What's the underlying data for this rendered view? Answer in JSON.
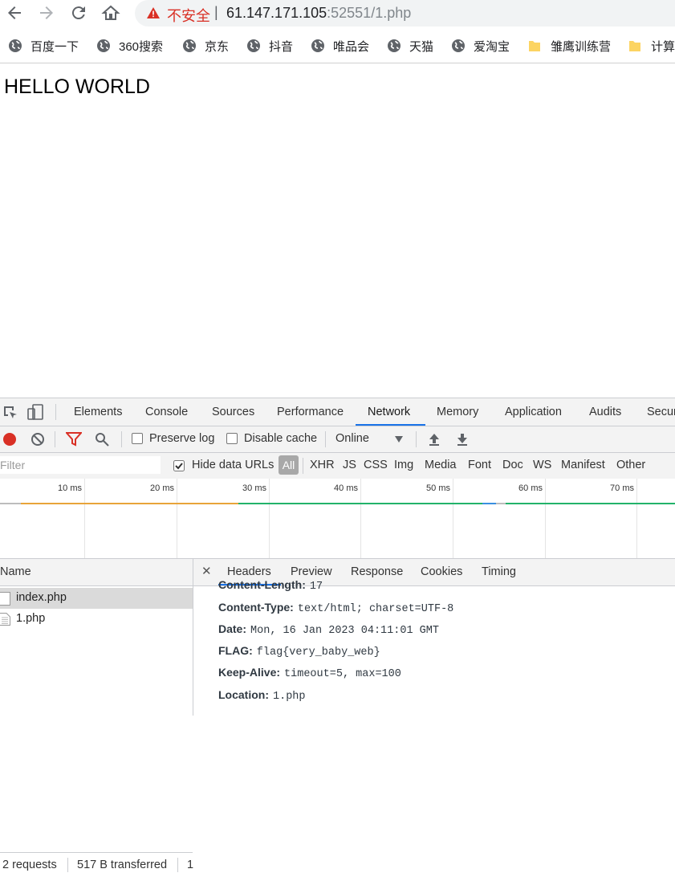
{
  "browser": {
    "security_label": "不安全",
    "url_host": "61.147.171.105",
    "url_port": ":52551",
    "url_path": "/1.php",
    "bookmarks": [
      {
        "label": "百度一下",
        "icon": "globe-icon"
      },
      {
        "label": "360搜索",
        "icon": "globe-icon"
      },
      {
        "label": "京东",
        "icon": "globe-icon"
      },
      {
        "label": "抖音",
        "icon": "globe-icon"
      },
      {
        "label": "唯品会",
        "icon": "globe-icon"
      },
      {
        "label": "天猫",
        "icon": "globe-icon"
      },
      {
        "label": "爱淘宝",
        "icon": "globe-icon"
      },
      {
        "label": "雏鹰训练营",
        "icon": "folder-icon"
      },
      {
        "label": "计算",
        "icon": "folder-icon"
      }
    ]
  },
  "page": {
    "heading": "HELLO WORLD"
  },
  "devtools": {
    "tabs": [
      "Elements",
      "Console",
      "Sources",
      "Performance",
      "Network",
      "Memory",
      "Application",
      "Audits",
      "Secur"
    ],
    "active_tab": "Network",
    "controls": {
      "preserve_log": "Preserve log",
      "disable_cache": "Disable cache",
      "throttle": "Online"
    },
    "filter": {
      "placeholder": "Filter",
      "hide_data_urls": "Hide data URLs",
      "types": [
        "All",
        "XHR",
        "JS",
        "CSS",
        "Img",
        "Media",
        "Font",
        "Doc",
        "WS",
        "Manifest",
        "Other"
      ],
      "active_type": "All"
    },
    "timeline": {
      "ticks": [
        "10 ms",
        "20 ms",
        "30 ms",
        "40 ms",
        "50 ms",
        "60 ms",
        "70 ms"
      ]
    },
    "requests": {
      "column": "Name",
      "items": [
        "index.php",
        "1.php"
      ],
      "selected": "index.php",
      "summary_count": "2 requests",
      "summary_transfer": "517 B transferred",
      "summary_extra": "1"
    },
    "detail": {
      "tabs": [
        "Headers",
        "Preview",
        "Response",
        "Cookies",
        "Timing"
      ],
      "active_tab": "Headers",
      "headers": [
        {
          "key": "Content-Length:",
          "value": "17"
        },
        {
          "key": "Content-Type:",
          "value": "text/html; charset=UTF-8"
        },
        {
          "key": "Date:",
          "value": "Mon, 16 Jan 2023 04:11:01 GMT"
        },
        {
          "key": "FLAG:",
          "value": "flag{very_baby_web}"
        },
        {
          "key": "Keep-Alive:",
          "value": "timeout=5, max=100"
        },
        {
          "key": "Location:",
          "value": "1.php"
        }
      ]
    },
    "colors": {
      "accent": "#1a73e8",
      "record": "#d93025",
      "filter_icon": "#d93025",
      "waterfall_orange": "#e8a43a",
      "waterfall_green": "#22b36a"
    }
  }
}
